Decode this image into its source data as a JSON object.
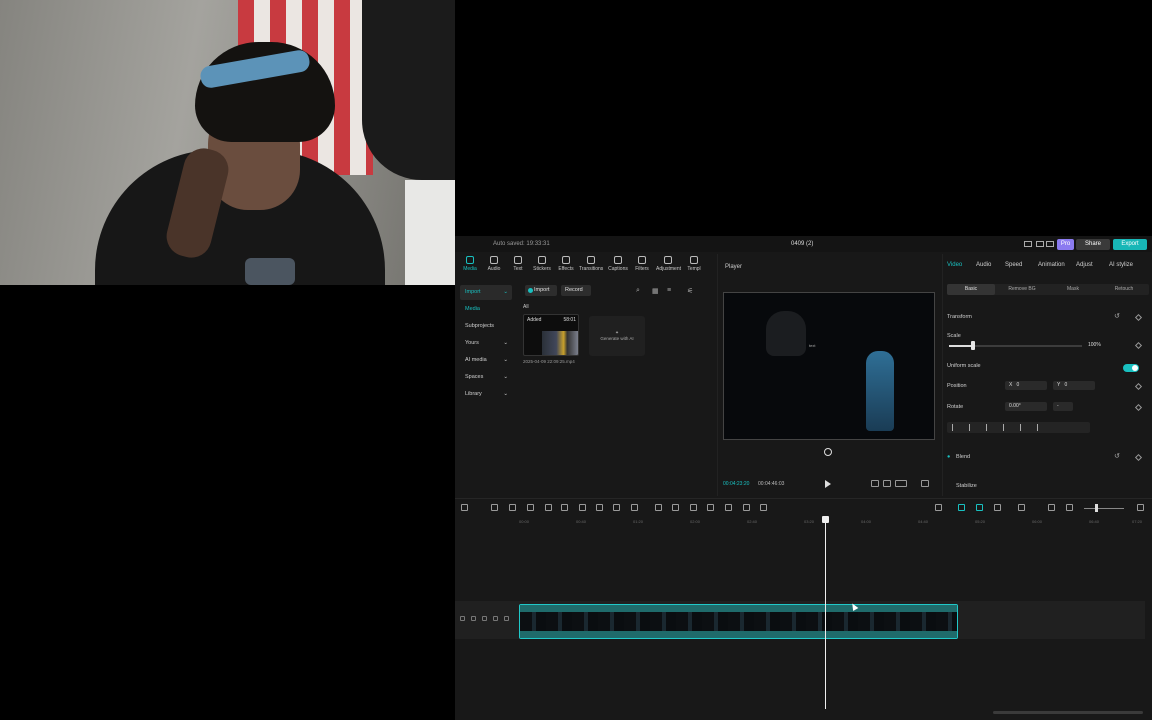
{
  "app": {
    "autosave": "Auto saved: 19:33:31",
    "project_title": "0409 (2)",
    "pro_label": "Pro",
    "share_label": "Share",
    "export_label": "Export"
  },
  "toolbar": {
    "items": [
      "Media",
      "Audio",
      "Text",
      "Stickers",
      "Effects",
      "Transitions",
      "Captions",
      "Filters",
      "Adjustment",
      "Templ"
    ]
  },
  "leftnav": {
    "items": [
      "Import",
      "Media",
      "Subprojects",
      "Yours",
      "AI media",
      "Spaces",
      "Library"
    ]
  },
  "media": {
    "import_label": "Import",
    "record_label": "Record",
    "all_label": "All",
    "clip_added": "Added",
    "clip_duration": "58:01",
    "clip_name": "2025-04-09 22:09:25.mp4",
    "generate_label": "Generate with AI"
  },
  "player": {
    "title": "Player",
    "current_time": "00:04:23:20",
    "total_time": "00:04:46:03",
    "video_text": "text"
  },
  "properties": {
    "tabs": [
      "Video",
      "Audio",
      "Speed",
      "Animation",
      "Adjust",
      "AI stylize"
    ],
    "subtabs": [
      "Basic",
      "Remove BG",
      "Mask",
      "Retouch"
    ],
    "transform_label": "Transform",
    "scale_label": "Scale",
    "scale_value": "100%",
    "scale_fraction": 0.18,
    "uniform_scale_label": "Uniform scale",
    "position_label": "Position",
    "pos_x_label": "X",
    "pos_x": "0",
    "pos_y_label": "Y",
    "pos_y": "0",
    "rotate_label": "Rotate",
    "rotate_value": "0.00°",
    "rotate_dash": "-",
    "blend_label": "Blend",
    "stabilize_label": "Stabilize"
  },
  "timeline": {
    "ruler": [
      "00:00",
      "00:40",
      "01:20",
      "02:00",
      "02:40",
      "03:20",
      "04:00",
      "04:40",
      "05:20",
      "06:00",
      "06:40",
      "07:20"
    ]
  },
  "colors": {
    "accent": "#19c0c0",
    "pro": "#8b7bf0",
    "background": "#181818"
  }
}
